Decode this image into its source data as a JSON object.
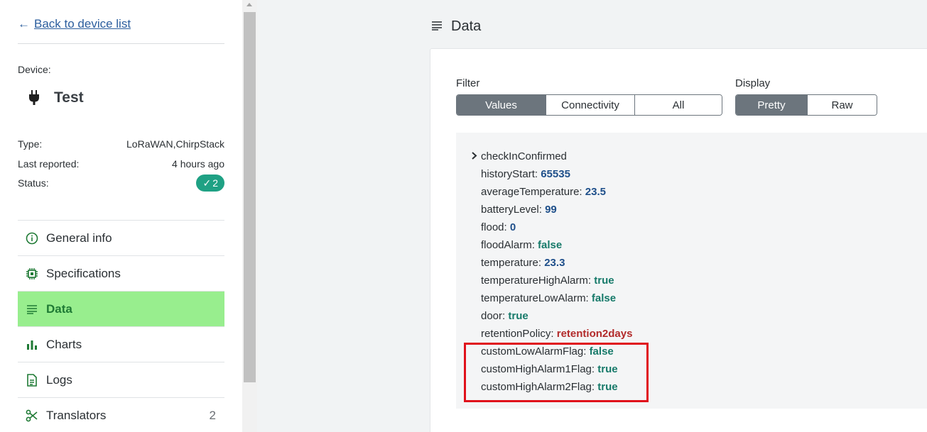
{
  "sidebar": {
    "back_label": "Back to device list",
    "back_arrow": "←",
    "device_caption": "Device:",
    "device_name": "Test",
    "device_icon": "plug-icon",
    "meta": {
      "type_label": "Type:",
      "type_value": "LoRaWAN,ChirpStack",
      "reported_label": "Last reported:",
      "reported_value": "4 hours ago",
      "status_label": "Status:",
      "status_check": "✓",
      "status_count": "2"
    },
    "nav": [
      {
        "label": "General info",
        "icon": "info-circle-icon"
      },
      {
        "label": "Specifications",
        "icon": "chip-icon"
      },
      {
        "label": "Data",
        "icon": "list-lines-icon",
        "active": true
      },
      {
        "label": "Charts",
        "icon": "bar-chart-icon"
      },
      {
        "label": "Logs",
        "icon": "document-icon"
      },
      {
        "label": "Translators",
        "icon": "scissors-icon",
        "count": "2"
      }
    ]
  },
  "main": {
    "title": "Data",
    "filter": {
      "label": "Filter",
      "options": [
        "Values",
        "Connectivity",
        "All"
      ],
      "selected": "Values"
    },
    "display": {
      "label": "Display",
      "options": [
        "Pretty",
        "Raw"
      ],
      "selected": "Pretty"
    },
    "data": {
      "collapsed_key": "checkInConfirmed",
      "rows": [
        {
          "key": "historyStart:",
          "value": "65535",
          "kind": "num"
        },
        {
          "key": "averageTemperature:",
          "value": "23.5",
          "kind": "num"
        },
        {
          "key": "batteryLevel:",
          "value": "99",
          "kind": "num"
        },
        {
          "key": "flood:",
          "value": "0",
          "kind": "num"
        },
        {
          "key": "floodAlarm:",
          "value": "false",
          "kind": "bool"
        },
        {
          "key": "temperature:",
          "value": "23.3",
          "kind": "num"
        },
        {
          "key": "temperatureHighAlarm:",
          "value": "true",
          "kind": "bool"
        },
        {
          "key": "temperatureLowAlarm:",
          "value": "false",
          "kind": "bool"
        },
        {
          "key": "door:",
          "value": "true",
          "kind": "bool"
        },
        {
          "key": "retentionPolicy:",
          "value": "retention2days",
          "kind": "str"
        },
        {
          "key": "customLowAlarmFlag:",
          "value": "false",
          "kind": "bool"
        },
        {
          "key": "customHighAlarm1Flag:",
          "value": "true",
          "kind": "bool"
        },
        {
          "key": "customHighAlarm2Flag:",
          "value": "true",
          "kind": "bool"
        }
      ]
    }
  },
  "colors": {
    "active_nav_bg": "#98ee8e",
    "status_badge": "#1fa184",
    "highlight_box": "#e0111b",
    "segment_selected": "#6c757d"
  }
}
